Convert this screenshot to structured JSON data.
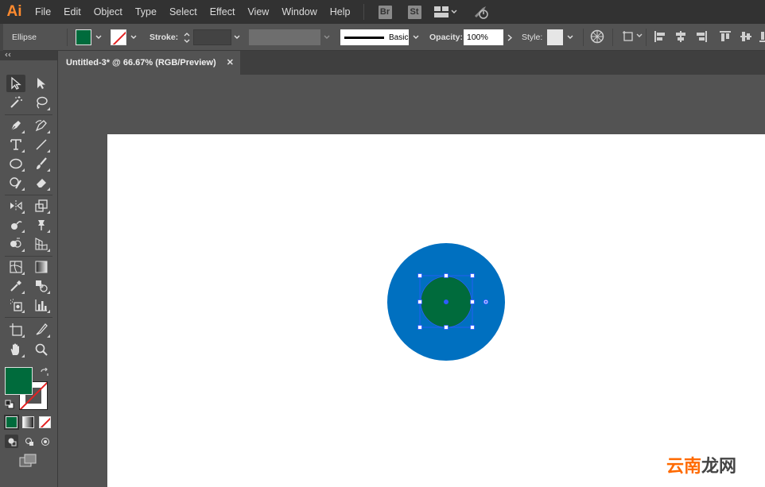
{
  "app": {
    "logo": "Ai"
  },
  "menu": {
    "items": [
      "File",
      "Edit",
      "Object",
      "Type",
      "Select",
      "Effect",
      "View",
      "Window",
      "Help"
    ],
    "bridge_label": "Br",
    "stock_label": "St"
  },
  "control_bar": {
    "object_type": "Ellipse",
    "fill_color": "#006B3C",
    "stroke_label": "Stroke:",
    "brush_label": "Basic",
    "opacity_label": "Opacity:",
    "opacity_value": "100%",
    "style_label": "Style:"
  },
  "document": {
    "tab_title": "Untitled-3* @ 66.67% (RGB/Preview)",
    "close_glyph": "✕"
  },
  "artwork": {
    "outer_circle_color": "#0070C0",
    "inner_circle_color": "#006B3C",
    "selection_color": "#2E5BFF"
  },
  "toolbar": {
    "fill_color": "#006B3C",
    "stroke_color": "#FFFFFF"
  },
  "watermark": {
    "highlight": "云南",
    "rest": "龙网"
  }
}
